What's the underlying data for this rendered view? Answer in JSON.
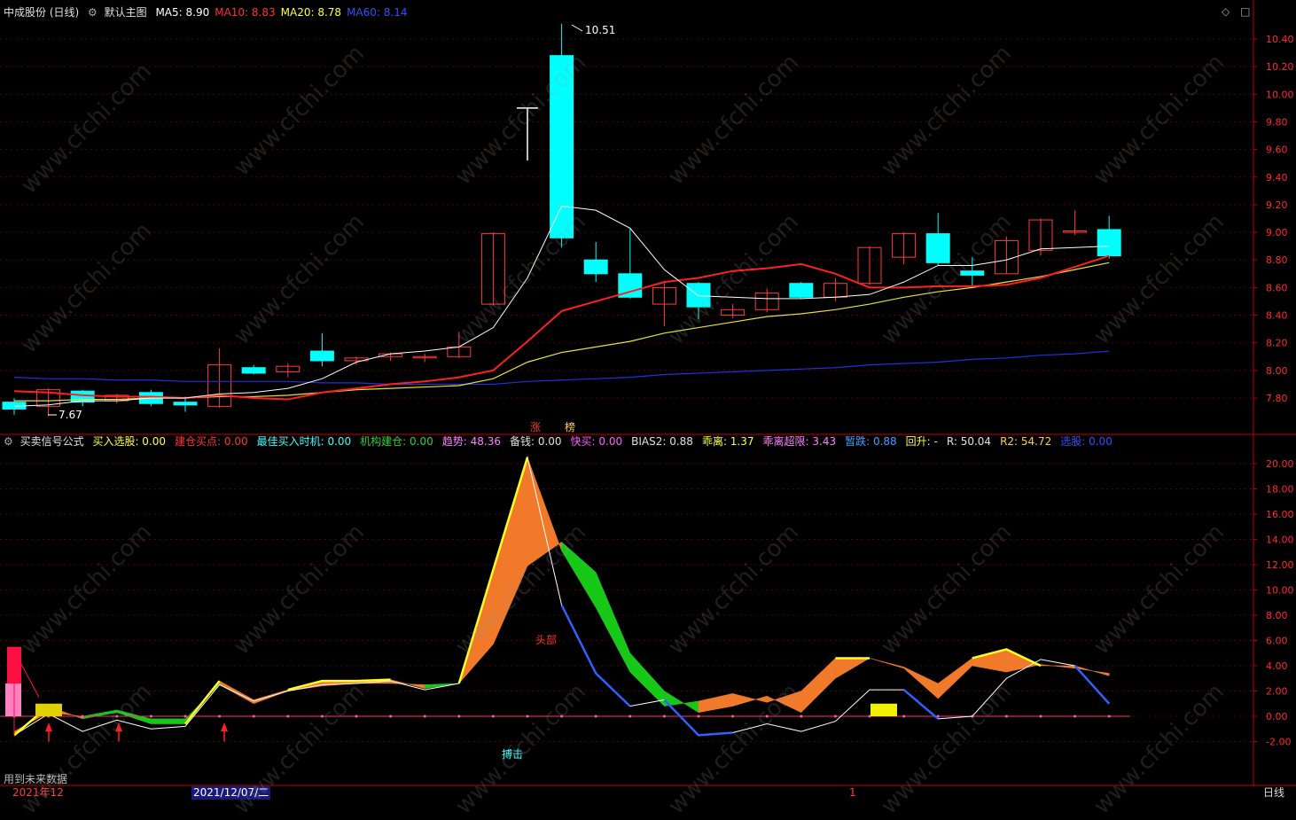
{
  "header": {
    "stock": "中成股份 (日线)",
    "main_chart": "默认主图",
    "ma": [
      {
        "label": "MA5: 8.90",
        "color": "#ffffff"
      },
      {
        "label": "MA10: 8.83",
        "color": "#ff3030"
      },
      {
        "label": "MA20: 8.78",
        "color": "#ffff40"
      },
      {
        "label": "MA60: 8.14",
        "color": "#3050ff"
      }
    ]
  },
  "indicator": {
    "name": "买卖信号公式",
    "items": [
      {
        "label": "买入选股: 0.00",
        "color": "#ffff40"
      },
      {
        "label": "建仓买点: 0.00",
        "color": "#ff3030"
      },
      {
        "label": "最佳买入时机: 0.00",
        "color": "#40ffff"
      },
      {
        "label": "机构建仓: 0.00",
        "color": "#30d030"
      },
      {
        "label": "趋势: 48.36",
        "color": "#ff80ff"
      },
      {
        "label": "备钱: 0.00",
        "color": "#e0e0e0"
      },
      {
        "label": "快买: 0.00",
        "color": "#ff60ff"
      },
      {
        "label": "BIAS2: 0.88",
        "color": "#e0e0e0"
      },
      {
        "label": "乖离: 1.37",
        "color": "#ffff40"
      },
      {
        "label": "乖离超限: 3.43",
        "color": "#ff80ff"
      },
      {
        "label": "暂跌: 0.88",
        "color": "#40a0ff"
      },
      {
        "label": "回升: -",
        "color": "#ffff40"
      },
      {
        "label": "R: 50.04",
        "color": "#e0e0e0"
      },
      {
        "label": "R2: 54.72",
        "color": "#ffd040"
      },
      {
        "label": "选股: 0.00",
        "color": "#3050ff"
      }
    ]
  },
  "annotations": {
    "high": "10.51",
    "low": "7.67",
    "zhang": "涨",
    "bang": "榜",
    "head": "头部",
    "strike": "搏击",
    "future": "用到未来数据"
  },
  "statusbar": {
    "left": "2021年12",
    "cursor_date": "2021/12/07/二",
    "mark": "1",
    "period": "日线"
  },
  "watermark": "www.cfchi.com",
  "icons": [
    "diamond-icon",
    "square-icon"
  ],
  "colors": {
    "up": "#ff3a3a",
    "down": "#00ffff",
    "axis": "#c00000"
  },
  "price_axis": [
    "10.40",
    "10.20",
    "10.00",
    "9.80",
    "9.60",
    "9.40",
    "9.20",
    "9.00",
    "8.80",
    "8.60",
    "8.40",
    "8.20",
    "8.00",
    "7.80"
  ],
  "ind_axis": [
    "20.00",
    "18.00",
    "16.00",
    "14.00",
    "12.00",
    "10.00",
    "8.00",
    "6.00",
    "4.00",
    "2.00",
    "0.00",
    "-2.00"
  ],
  "chart_data": {
    "type": "candlestick",
    "price_range": [
      7.65,
      10.55
    ],
    "indicator_range": [
      -3.5,
      21.0
    ],
    "candles": [
      {
        "o": 7.77,
        "h": 7.8,
        "l": 7.68,
        "c": 7.72
      },
      {
        "o": 7.74,
        "h": 7.87,
        "l": 7.67,
        "c": 7.86
      },
      {
        "o": 7.85,
        "h": 7.86,
        "l": 7.74,
        "c": 7.77
      },
      {
        "o": 7.78,
        "h": 7.83,
        "l": 7.76,
        "c": 7.82
      },
      {
        "o": 7.84,
        "h": 7.86,
        "l": 7.74,
        "c": 7.76
      },
      {
        "o": 7.77,
        "h": 7.81,
        "l": 7.7,
        "c": 7.75
      },
      {
        "o": 7.74,
        "h": 8.16,
        "l": 7.73,
        "c": 8.04
      },
      {
        "o": 8.02,
        "h": 8.04,
        "l": 7.97,
        "c": 7.98
      },
      {
        "o": 7.99,
        "h": 8.05,
        "l": 7.95,
        "c": 8.03
      },
      {
        "o": 8.14,
        "h": 8.27,
        "l": 8.03,
        "c": 8.07
      },
      {
        "o": 8.07,
        "h": 8.1,
        "l": 8.04,
        "c": 8.09
      },
      {
        "o": 8.1,
        "h": 8.13,
        "l": 8.07,
        "c": 8.12
      },
      {
        "o": 8.1,
        "h": 8.12,
        "l": 8.06,
        "c": 8.1
      },
      {
        "o": 8.1,
        "h": 8.28,
        "l": 8.09,
        "c": 8.17
      },
      {
        "o": 8.48,
        "h": 9.0,
        "l": 8.47,
        "c": 8.99
      },
      {
        "o": 9.9,
        "h": 9.9,
        "l": 9.52,
        "c": 9.9
      },
      {
        "o": 10.28,
        "h": 10.51,
        "l": 8.89,
        "c": 8.96
      },
      {
        "o": 8.8,
        "h": 8.93,
        "l": 8.64,
        "c": 8.7
      },
      {
        "o": 8.7,
        "h": 9.03,
        "l": 8.52,
        "c": 8.53
      },
      {
        "o": 8.48,
        "h": 8.64,
        "l": 8.32,
        "c": 8.6
      },
      {
        "o": 8.63,
        "h": 8.64,
        "l": 8.37,
        "c": 8.46
      },
      {
        "o": 8.4,
        "h": 8.48,
        "l": 8.38,
        "c": 8.44
      },
      {
        "o": 8.44,
        "h": 8.59,
        "l": 8.42,
        "c": 8.56
      },
      {
        "o": 8.63,
        "h": 8.64,
        "l": 8.52,
        "c": 8.53
      },
      {
        "o": 8.53,
        "h": 8.67,
        "l": 8.5,
        "c": 8.63
      },
      {
        "o": 8.63,
        "h": 8.9,
        "l": 8.62,
        "c": 8.89
      },
      {
        "o": 8.82,
        "h": 9.0,
        "l": 8.77,
        "c": 8.99
      },
      {
        "o": 8.99,
        "h": 9.14,
        "l": 8.76,
        "c": 8.78
      },
      {
        "o": 8.72,
        "h": 8.82,
        "l": 8.6,
        "c": 8.69
      },
      {
        "o": 8.7,
        "h": 8.97,
        "l": 8.7,
        "c": 8.94
      },
      {
        "o": 8.87,
        "h": 9.1,
        "l": 8.83,
        "c": 9.09
      },
      {
        "o": 9.0,
        "h": 9.16,
        "l": 8.98,
        "c": 9.01
      },
      {
        "o": 9.02,
        "h": 9.12,
        "l": 8.81,
        "c": 8.83
      }
    ],
    "ma5": [
      7.74,
      7.75,
      7.78,
      7.78,
      7.8,
      7.8,
      7.83,
      7.84,
      7.87,
      7.94,
      8.06,
      8.12,
      8.14,
      8.17,
      8.31,
      8.67,
      9.19,
      9.16,
      9.03,
      8.73,
      8.54,
      8.53,
      8.52,
      8.52,
      8.53,
      8.55,
      8.64,
      8.76,
      8.76,
      8.8,
      8.88,
      8.89,
      8.9
    ],
    "ma10": [
      7.85,
      7.84,
      7.82,
      7.81,
      7.81,
      7.8,
      7.82,
      7.8,
      7.79,
      7.84,
      7.87,
      7.9,
      7.92,
      7.95,
      8.0,
      8.21,
      8.43,
      8.5,
      8.57,
      8.64,
      8.67,
      8.72,
      8.74,
      8.77,
      8.7,
      8.6,
      8.6,
      8.61,
      8.61,
      8.62,
      8.67,
      8.75,
      8.83
    ],
    "ma20": [
      7.78,
      7.78,
      7.79,
      7.79,
      7.8,
      7.8,
      7.81,
      7.81,
      7.82,
      7.84,
      7.86,
      7.87,
      7.88,
      7.89,
      7.94,
      8.06,
      8.13,
      8.17,
      8.21,
      8.27,
      8.31,
      8.35,
      8.39,
      8.41,
      8.44,
      8.48,
      8.53,
      8.57,
      8.6,
      8.64,
      8.68,
      8.73,
      8.78
    ],
    "ma60": [
      7.95,
      7.94,
      7.94,
      7.93,
      7.93,
      7.92,
      7.92,
      7.92,
      7.92,
      7.91,
      7.91,
      7.9,
      7.9,
      7.9,
      7.9,
      7.92,
      7.93,
      7.94,
      7.95,
      7.97,
      7.98,
      7.99,
      8.0,
      8.01,
      8.02,
      8.04,
      8.05,
      8.06,
      8.08,
      8.09,
      8.11,
      8.12,
      8.14
    ],
    "ind_x": [
      0,
      1,
      2,
      3,
      4,
      5,
      6,
      7,
      8,
      9,
      10,
      11,
      12,
      13,
      14,
      15,
      16,
      17,
      18,
      19,
      20,
      21,
      22,
      23,
      24,
      25,
      26,
      27,
      28,
      29,
      30,
      31,
      32
    ],
    "trend_a": [
      -1.5,
      0.8,
      -0.2,
      0.3,
      -0.6,
      -0.6,
      2.8,
      1.3,
      2.1,
      2.8,
      2.8,
      2.9,
      2.2,
      2.6,
      11.6,
      20.5,
      13.1,
      8.6,
      3.5,
      0.8,
      1.2,
      1.8,
      1.1,
      2.0,
      4.6,
      4.6,
      3.9,
      2.6,
      4.6,
      5.3,
      4.0,
      4.0,
      3.2
    ],
    "trend_b": [
      -1.2,
      0.3,
      0.0,
      0.5,
      -0.2,
      -0.2,
      2.5,
      1.0,
      2.0,
      2.4,
      2.6,
      2.6,
      2.5,
      2.6,
      5.7,
      11.9,
      13.8,
      11.4,
      5.0,
      2.0,
      0.3,
      0.8,
      1.6,
      0.3,
      3.0,
      4.6,
      3.8,
      1.4,
      4.0,
      3.5,
      4.1,
      3.8,
      3.4
    ],
    "white": [
      -1.5,
      0.2,
      -1.2,
      -0.3,
      -1.0,
      -0.8,
      2.5,
      1.2,
      2.0,
      2.5,
      2.6,
      2.8,
      2.1,
      2.6,
      11.5,
      20.5,
      8.8,
      3.4,
      0.8,
      1.3,
      -1.5,
      -1.3,
      -0.6,
      -1.2,
      -0.4,
      2.1,
      2.1,
      -0.2,
      0.0,
      3.0,
      4.5,
      4.0,
      1.0
    ],
    "blue_segments": [
      [
        16,
        17,
        18
      ],
      [
        19,
        20,
        21
      ],
      [
        26,
        27
      ],
      [
        31,
        32
      ]
    ],
    "yellow_segments": [
      [
        0,
        1
      ],
      [
        5,
        6
      ],
      [
        8,
        9,
        10,
        11
      ],
      [
        13,
        14,
        15
      ],
      [
        24,
        25
      ],
      [
        28,
        29,
        30
      ]
    ]
  }
}
